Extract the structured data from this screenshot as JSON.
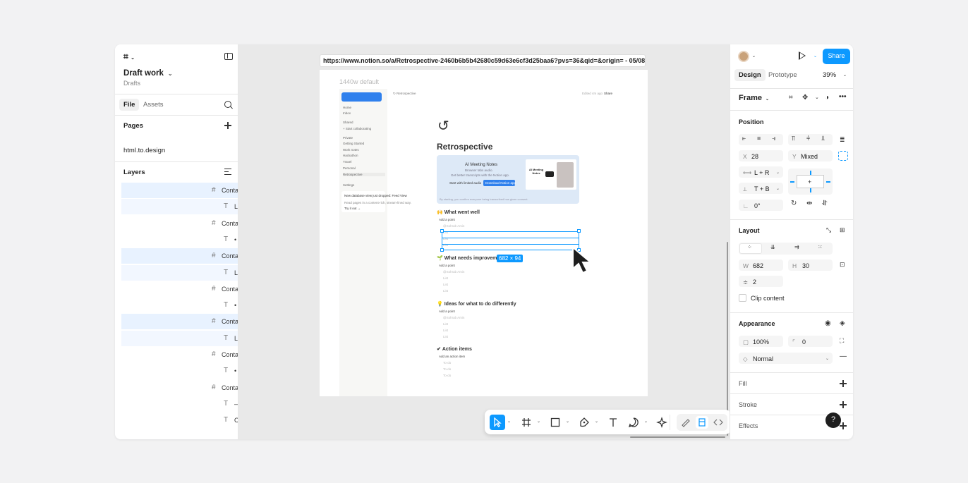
{
  "left_panel": {
    "file_name": "Draft work",
    "file_location": "Drafts",
    "tabs": [
      "File",
      "Assets"
    ],
    "pages_label": "Pages",
    "pages": [
      "html.to.design"
    ],
    "layers_label": "Layers",
    "layers": [
      {
        "glyph": "#",
        "label": "Conta",
        "indent": 0,
        "state": "sel"
      },
      {
        "glyph": "T",
        "label": "Li",
        "indent": 1,
        "state": "sel2"
      },
      {
        "glyph": "#",
        "label": "Conta",
        "indent": 0,
        "state": ""
      },
      {
        "glyph": "T",
        "label": "•",
        "indent": 1,
        "state": ""
      },
      {
        "glyph": "#",
        "label": "Conta",
        "indent": 0,
        "state": "sel"
      },
      {
        "glyph": "T",
        "label": "Li",
        "indent": 1,
        "state": "sel2"
      },
      {
        "glyph": "#",
        "label": "Conta",
        "indent": 0,
        "state": ""
      },
      {
        "glyph": "T",
        "label": "•",
        "indent": 1,
        "state": ""
      },
      {
        "glyph": "#",
        "label": "Conta",
        "indent": 0,
        "state": "sel"
      },
      {
        "glyph": "T",
        "label": "Li",
        "indent": 1,
        "state": "sel2"
      },
      {
        "glyph": "#",
        "label": "Conta",
        "indent": 0,
        "state": ""
      },
      {
        "glyph": "T",
        "label": "•",
        "indent": 1,
        "state": ""
      },
      {
        "glyph": "#",
        "label": "Conta",
        "indent": 0,
        "state": ""
      },
      {
        "glyph": "T",
        "label": "–",
        "indent": 1,
        "state": ""
      },
      {
        "glyph": "T",
        "label": "C",
        "indent": 1,
        "state": ""
      }
    ]
  },
  "canvas": {
    "url": "https://www.notion.so/a/Retrospective-2460b6b5b42680c59d63e6cf3d25baa6?pvs=36&qid=&origin= - 05/08/202...",
    "frame_label": "1440w default",
    "selection_size": "682 × 94",
    "notion": {
      "sidebar_items": [
        "Home",
        "Inbox",
        "Shared",
        "+ Start collaborating",
        "Private",
        "Getting Started",
        "Work notes",
        "Hackathon",
        "Travel",
        "Personal",
        "Retrospective",
        "Settings"
      ],
      "breadcrumb": "Retrospective",
      "top_right": "Edited 4m ago",
      "share": "Share",
      "title": "Retrospective",
      "banner_title": "AI Meeting Notes",
      "banner_sub": "Browser tabs audio.",
      "banner_sub2": "Get better transcripts with the Notion app.",
      "banner_start": "Start with limited audio",
      "banner_btn": "Download Notion app",
      "banner_foot": "By starting, you confirm everyone being transcribed has given consent.",
      "thumb_label": "AI Meeting Notes",
      "card_title": "New database view just dropped: Feed View",
      "card_body": "Read pages in a content-rich, stream-lined way.",
      "card_cta": "Try it out →",
      "sections": [
        {
          "icon": "🙌",
          "title": "What went well",
          "add": "Add a point",
          "mention": "@Sohrab Amin",
          "items": [
            "List",
            "List",
            "List"
          ]
        },
        {
          "icon": "🌱",
          "title": "What needs improvement",
          "add": "Add a point",
          "mention": "@Sohrab Amin",
          "items": [
            "List",
            "List",
            "List"
          ]
        },
        {
          "icon": "💡",
          "title": "Ideas for what to do differently",
          "add": "Add a point",
          "mention": "@Sohrab Amin",
          "items": [
            "List",
            "List",
            "List"
          ]
        },
        {
          "icon": "✔",
          "title": "Action items",
          "add": "Add an action item",
          "mention": "",
          "items": [
            "To-do",
            "To-do",
            "To-do"
          ]
        }
      ]
    }
  },
  "toolbar": {
    "tools": [
      "move-tool",
      "frame-tool",
      "shape-tool",
      "pen-tool",
      "text-tool",
      "comment-tool",
      "actions-tool"
    ],
    "dev_tools": [
      "draw-mode",
      "design-mode",
      "dev-mode"
    ]
  },
  "right_panel": {
    "share_label": "Share",
    "tabs": [
      "Design",
      "Prototype"
    ],
    "zoom": "39%",
    "selection_type": "Frame",
    "position_label": "Position",
    "x_label": "X",
    "x_value": "28",
    "y_label": "Y",
    "y_value": "Mixed",
    "h_constraint": "L + R",
    "v_constraint": "T + B",
    "rotation": "0°",
    "layout_label": "Layout",
    "w_label": "W",
    "w_value": "682",
    "h_label": "H",
    "h_value": "30",
    "gap_value": "2",
    "clip_content": "Clip content",
    "appearance_label": "Appearance",
    "opacity": "100%",
    "radius": "0",
    "blend": "Normal",
    "fill_label": "Fill",
    "stroke_label": "Stroke",
    "effects_label": "Effects",
    "help": "?"
  },
  "colors": {
    "accent": "#0d99ff",
    "canvas_bg": "#e9e9e9",
    "notion_blue": "#2f80ed"
  }
}
